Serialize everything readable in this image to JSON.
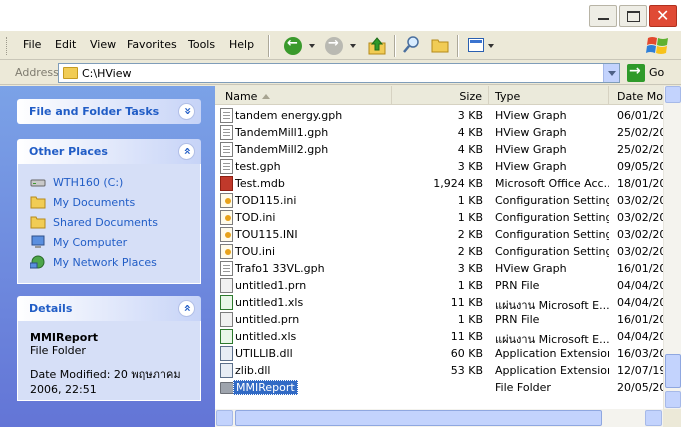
{
  "menu": {
    "file": "File",
    "edit": "Edit",
    "view": "View",
    "favorites": "Favorites",
    "tools": "Tools",
    "help": "Help"
  },
  "address": {
    "label": "Address",
    "value": "C:\\HView",
    "go_label": "Go"
  },
  "taskpane": {
    "file_folder_tasks_title": "File and Folder Tasks",
    "other_places_title": "Other Places",
    "other_places": [
      {
        "label": "WTH160 (C:)",
        "icon": "drive-icon"
      },
      {
        "label": "My Documents",
        "icon": "folder-icon"
      },
      {
        "label": "Shared Documents",
        "icon": "folder-icon"
      },
      {
        "label": "My Computer",
        "icon": "computer-icon"
      },
      {
        "label": "My Network Places",
        "icon": "network-icon"
      }
    ],
    "details_title": "Details",
    "details": {
      "name": "MMIReport",
      "type": "File Folder",
      "modified_line1": "Date Modified: 20 พฤษภาคม",
      "modified_line2": "2006, 22:51"
    }
  },
  "columns": {
    "name": "Name",
    "size": "Size",
    "type": "Type",
    "date": "Date Mo"
  },
  "files": [
    {
      "name": "tandem energy.gph",
      "size": "3 KB",
      "type": "HView Graph",
      "date": "06/01/20",
      "icon": "gph"
    },
    {
      "name": "TandemMill1.gph",
      "size": "4 KB",
      "type": "HView Graph",
      "date": "25/02/20",
      "icon": "gph"
    },
    {
      "name": "TandemMill2.gph",
      "size": "4 KB",
      "type": "HView Graph",
      "date": "25/02/20",
      "icon": "gph"
    },
    {
      "name": "test.gph",
      "size": "3 KB",
      "type": "HView Graph",
      "date": "09/05/20",
      "icon": "gph"
    },
    {
      "name": "Test.mdb",
      "size": "1,924 KB",
      "type": "Microsoft Office Acc...",
      "date": "18/01/20",
      "icon": "mdb"
    },
    {
      "name": "TOD115.ini",
      "size": "1 KB",
      "type": "Configuration Settings",
      "date": "03/02/20",
      "icon": "ini"
    },
    {
      "name": "TOD.ini",
      "size": "1 KB",
      "type": "Configuration Settings",
      "date": "03/02/20",
      "icon": "ini"
    },
    {
      "name": "TOU115.INI",
      "size": "2 KB",
      "type": "Configuration Settings",
      "date": "03/02/20",
      "icon": "ini"
    },
    {
      "name": "TOU.ini",
      "size": "2 KB",
      "type": "Configuration Settings",
      "date": "03/02/20",
      "icon": "ini"
    },
    {
      "name": "Trafo1 33VL.gph",
      "size": "3 KB",
      "type": "HView Graph",
      "date": "16/01/20",
      "icon": "gph"
    },
    {
      "name": "untitled1.prn",
      "size": "1 KB",
      "type": "PRN File",
      "date": "04/04/20",
      "icon": "prn"
    },
    {
      "name": "untitled1.xls",
      "size": "11 KB",
      "type": "แผ่นงาน Microsoft E...",
      "date": "04/04/20",
      "icon": "xls"
    },
    {
      "name": "untitled.prn",
      "size": "1 KB",
      "type": "PRN File",
      "date": "16/01/20",
      "icon": "prn"
    },
    {
      "name": "untitled.xls",
      "size": "11 KB",
      "type": "แผ่นงาน Microsoft E...",
      "date": "04/04/20",
      "icon": "xls"
    },
    {
      "name": "UTILLIB.dll",
      "size": "60 KB",
      "type": "Application Extension",
      "date": "16/03/20",
      "icon": "dll"
    },
    {
      "name": "zlib.dll",
      "size": "53 KB",
      "type": "Application Extension",
      "date": "12/07/19",
      "icon": "dll"
    },
    {
      "name": "MMIReport",
      "size": "",
      "type": "File Folder",
      "date": "20/05/20",
      "icon": "folder",
      "selected": true
    }
  ],
  "colors": {
    "taskpane_gradient_top": "#7ba2e7",
    "taskpane_gradient_bottom": "#6375d6",
    "link_blue": "#215dc6",
    "selection": "#316ac5",
    "close_button": "#e04a35"
  }
}
